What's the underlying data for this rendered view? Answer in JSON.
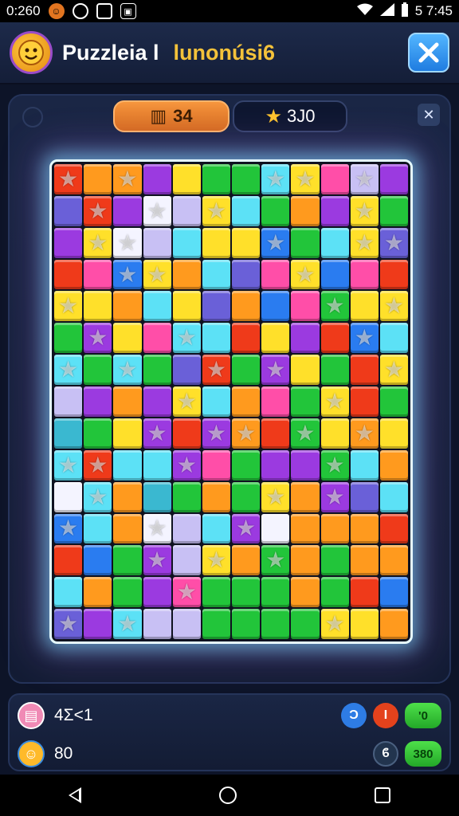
{
  "status": {
    "left_text": "0:260",
    "time": "5 7:45",
    "icons": [
      "notif-orange-icon",
      "sync-icon",
      "record-icon",
      "sim-icon",
      "wifi-icon",
      "signal-icon",
      "battery-icon"
    ]
  },
  "header": {
    "title": "Puzzleia l",
    "subtitle": "lunonúsi6",
    "close_icon": "close-icon"
  },
  "hud": {
    "score": "34",
    "stars": "3J0",
    "shuffle_icon": "shuffle-icon"
  },
  "board": {
    "rows": 15,
    "cols": 12,
    "palette": {
      "R": "#ef3a1a",
      "O": "#ff9a1e",
      "Y": "#ffe02a",
      "G": "#22c53a",
      "B": "#2a7cf0",
      "C": "#5ce1f6",
      "P": "#9b3ae0",
      "K": "#ff4ea8",
      "L": "#c8c0f4",
      "V": "#6a60d8",
      "W": "#f4f4ff",
      "T": "#3ab8d0"
    },
    "grid": [
      [
        "R",
        "O",
        "O",
        "P",
        "Y",
        "G",
        "G",
        "C",
        "Y",
        "K",
        "L",
        "P"
      ],
      [
        "V",
        "R",
        "P",
        "W",
        "L",
        "Y",
        "C",
        "G",
        "O",
        "P",
        "Y",
        "G"
      ],
      [
        "P",
        "Y",
        "W",
        "L",
        "C",
        "Y",
        "Y",
        "B",
        "G",
        "C",
        "Y",
        "V"
      ],
      [
        "R",
        "K",
        "B",
        "Y",
        "O",
        "C",
        "V",
        "K",
        "Y",
        "B",
        "K",
        "R"
      ],
      [
        "Y",
        "Y",
        "O",
        "C",
        "Y",
        "V",
        "O",
        "B",
        "K",
        "G",
        "Y",
        "Y"
      ],
      [
        "G",
        "P",
        "Y",
        "K",
        "C",
        "C",
        "R",
        "Y",
        "P",
        "R",
        "B",
        "C"
      ],
      [
        "C",
        "G",
        "C",
        "G",
        "V",
        "R",
        "G",
        "P",
        "Y",
        "G",
        "R",
        "Y"
      ],
      [
        "L",
        "P",
        "O",
        "P",
        "Y",
        "C",
        "O",
        "K",
        "G",
        "Y",
        "R",
        "G"
      ],
      [
        "T",
        "G",
        "Y",
        "P",
        "R",
        "P",
        "O",
        "R",
        "G",
        "Y",
        "O",
        "Y"
      ],
      [
        "C",
        "R",
        "C",
        "C",
        "P",
        "K",
        "G",
        "P",
        "P",
        "G",
        "C",
        "O"
      ],
      [
        "W",
        "C",
        "O",
        "T",
        "G",
        "O",
        "G",
        "Y",
        "O",
        "P",
        "V",
        "C"
      ],
      [
        "B",
        "C",
        "O",
        "W",
        "L",
        "C",
        "P",
        "W",
        "O",
        "O",
        "O",
        "R"
      ],
      [
        "R",
        "B",
        "G",
        "P",
        "L",
        "Y",
        "O",
        "G",
        "O",
        "G",
        "O",
        "O"
      ],
      [
        "C",
        "O",
        "G",
        "P",
        "K",
        "G",
        "G",
        "G",
        "O",
        "G",
        "R",
        "B"
      ],
      [
        "V",
        "P",
        "C",
        "L",
        "L",
        "G",
        "G",
        "G",
        "G",
        "Y",
        "Y",
        "O"
      ]
    ],
    "stars": [
      [
        0,
        0
      ],
      [
        0,
        2
      ],
      [
        0,
        7
      ],
      [
        0,
        8
      ],
      [
        0,
        10
      ],
      [
        1,
        1
      ],
      [
        1,
        3
      ],
      [
        1,
        5
      ],
      [
        1,
        10
      ],
      [
        2,
        1
      ],
      [
        2,
        2
      ],
      [
        2,
        7
      ],
      [
        2,
        10
      ],
      [
        2,
        11
      ],
      [
        3,
        2
      ],
      [
        3,
        3
      ],
      [
        3,
        8
      ],
      [
        4,
        0
      ],
      [
        4,
        11
      ],
      [
        4,
        9
      ],
      [
        5,
        1
      ],
      [
        5,
        4
      ],
      [
        5,
        10
      ],
      [
        6,
        0
      ],
      [
        6,
        2
      ],
      [
        6,
        5
      ],
      [
        6,
        7
      ],
      [
        6,
        11
      ],
      [
        7,
        4
      ],
      [
        7,
        9
      ],
      [
        8,
        3
      ],
      [
        8,
        5
      ],
      [
        8,
        6
      ],
      [
        8,
        8
      ],
      [
        8,
        10
      ],
      [
        9,
        0
      ],
      [
        9,
        1
      ],
      [
        9,
        4
      ],
      [
        9,
        9
      ],
      [
        10,
        1
      ],
      [
        10,
        7
      ],
      [
        10,
        9
      ],
      [
        11,
        0
      ],
      [
        11,
        3
      ],
      [
        11,
        6
      ],
      [
        12,
        3
      ],
      [
        12,
        5
      ],
      [
        12,
        7
      ],
      [
        13,
        4
      ],
      [
        14,
        0
      ],
      [
        14,
        2
      ],
      [
        14,
        9
      ]
    ]
  },
  "bottom": {
    "row1_value": "4Σ<1",
    "row2_value": "80",
    "row1_badges": [
      "Ͻ",
      "I"
    ],
    "row1_pill": "'0",
    "row2_badge": "ϐ",
    "row2_pill": "380"
  }
}
